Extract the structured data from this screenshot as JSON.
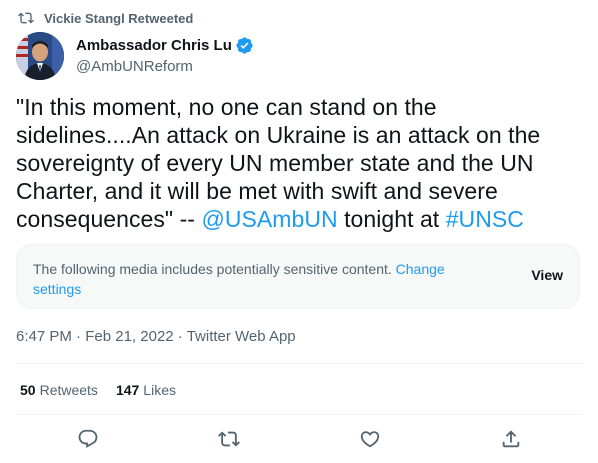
{
  "retweet_context": {
    "icon": "retweet-icon",
    "text": "Vickie Stangl Retweeted"
  },
  "author": {
    "display_name": "Ambassador Chris Lu",
    "handle": "@AmbUNReform",
    "verified": true,
    "verified_icon": "verified-badge-icon",
    "avatar_icon": "avatar"
  },
  "tweet": {
    "text_main": "\"In this moment, no one can stand on the sidelines....An attack on Ukraine is an attack on the sovereignty of every UN member state and the UN Charter, and it will be met with swift and severe consequences\" -- ",
    "mention": "@USAmbUN",
    "text_mid": " tonight at ",
    "hashtag": "#UNSC"
  },
  "sensitive_notice": {
    "message": "The following media includes potentially sensitive content. ",
    "settings_link": "Change settings",
    "view_label": "View"
  },
  "meta": {
    "time": "6:47 PM",
    "separator": " · ",
    "date": "Feb 21, 2022",
    "app": "Twitter Web App"
  },
  "stats": {
    "retweets_count": "50",
    "retweets_label": "Retweets",
    "likes_count": "147",
    "likes_label": "Likes"
  },
  "actions": {
    "reply_icon": "reply-icon",
    "retweet_icon": "retweet-icon",
    "like_icon": "like-icon",
    "share_icon": "share-icon"
  },
  "colors": {
    "link": "#1d9bf0",
    "secondary_text": "#536471",
    "primary_text": "#0f1419",
    "border": "#eff3f4"
  }
}
